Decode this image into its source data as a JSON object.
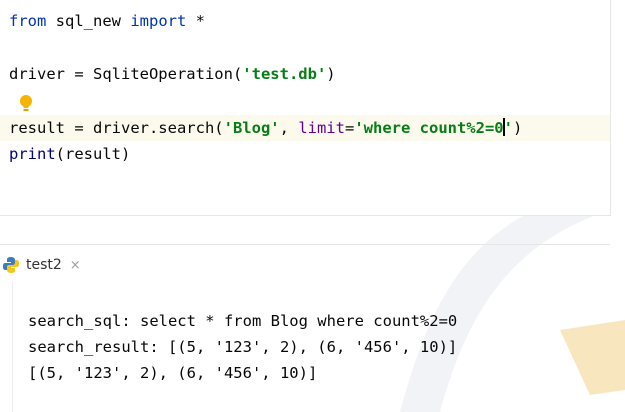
{
  "editor": {
    "line1": {
      "kw_from": "from",
      "module": " sql_new ",
      "kw_import": "import",
      "star": " *"
    },
    "line3": {
      "pre": "driver = SqliteOperation(",
      "arg": "'test.db'",
      "post": ")"
    },
    "line5": {
      "pre": "result = driver.search(",
      "arg1": "'Blog'",
      "comma": ", ",
      "param": "limit",
      "eq": "=",
      "arg2_a": "'where count%2=0",
      "arg2_b": "'",
      "post": ")"
    },
    "line6": {
      "fn": "print",
      "rest": "(result)"
    }
  },
  "run_tab": {
    "label": "test2",
    "close": "×"
  },
  "console": {
    "lines": [
      "search_sql: select * from Blog where count%2=0",
      "search_result: [(5, '123', 2), (6, '456', 10)]",
      "[(5, '123', 2), (6, '456', 10)]"
    ]
  },
  "colors": {
    "keyword": "#0033b3",
    "string": "#067d17",
    "param": "#660099",
    "bulb": "#f4b400"
  },
  "icons": {
    "bulb": "lightbulb-icon",
    "tab": "python-icon",
    "close": "close-icon"
  }
}
